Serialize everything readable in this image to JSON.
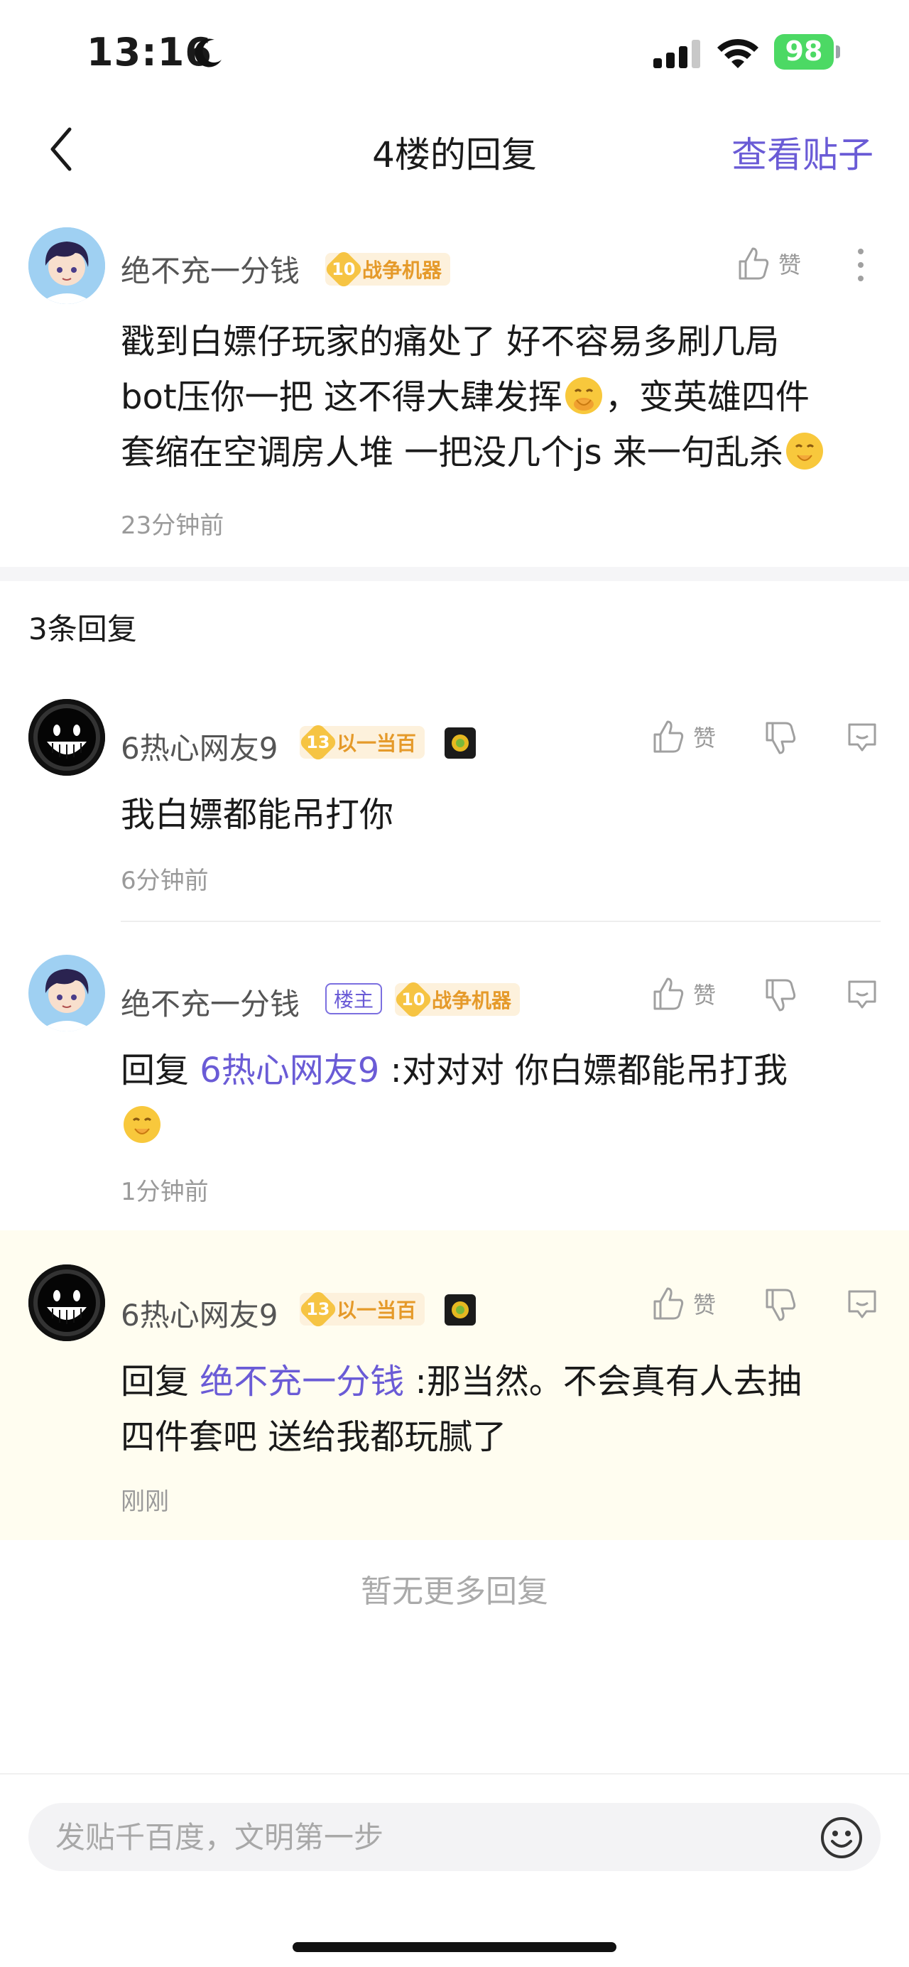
{
  "status_bar": {
    "time": "13:16",
    "battery": "98"
  },
  "nav": {
    "title": "4楼的回复",
    "right_action": "查看贴子"
  },
  "original": {
    "username": "绝不充一分钱",
    "level": "10",
    "badge": "战争机器",
    "like_label": "赞",
    "content_line1": "戳到白嫖仔玩家的痛处了 好不容易多刷几局",
    "content_line2": "bot压你一把 这不得大肆发挥",
    "content_line2b": "，变英雄四件",
    "content_line3": "套缩在空调房人堆 一把没几个js 来一句乱杀",
    "time": "23分钟前"
  },
  "reply_count": "3条回复",
  "replies": [
    {
      "username": "6热心网友9",
      "level": "13",
      "badge": "以一当百",
      "like_label": "赞",
      "content": "我白嫖都能吊打你",
      "time": "6分钟前"
    },
    {
      "username": "绝不充一分钱",
      "owner_tag": "楼主",
      "level": "10",
      "badge": "战争机器",
      "like_label": "赞",
      "reply_prefix": "回复 ",
      "mention": "6热心网友9",
      "content": " :对对对 你白嫖都能吊打我",
      "time": "1分钟前"
    },
    {
      "username": "6热心网友9",
      "level": "13",
      "badge": "以一当百",
      "like_label": "赞",
      "reply_prefix": "回复 ",
      "mention": "绝不充一分钱",
      "content": " :那当然。不会真有人去抽",
      "content2": "四件套吧 送给我都玩腻了",
      "time": "刚刚"
    }
  ],
  "no_more": "暂无更多回复",
  "input": {
    "placeholder": "发贴千百度，文明第一步"
  },
  "colors": {
    "accent": "#6a5bd6",
    "badge_gold": "#e59a2a",
    "highlight_bg": "#fffdf0"
  }
}
